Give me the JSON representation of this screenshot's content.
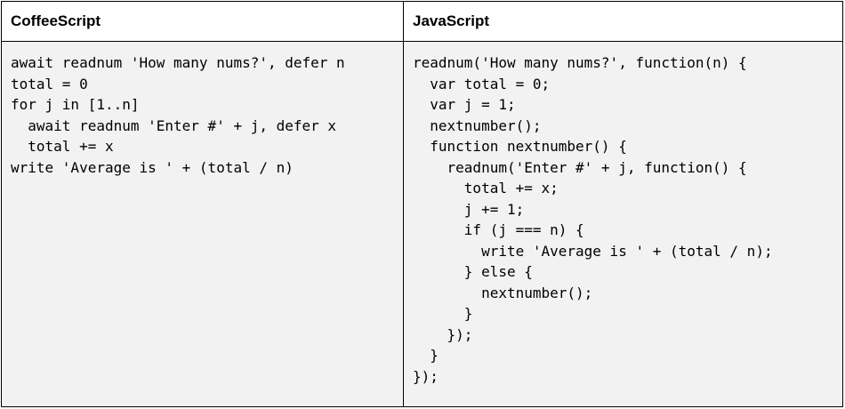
{
  "columns": [
    {
      "heading": "CoffeeScript",
      "code": "await readnum 'How many nums?', defer n\ntotal = 0\nfor j in [1..n]\n  await readnum 'Enter #' + j, defer x\n  total += x\nwrite 'Average is ' + (total / n)"
    },
    {
      "heading": "JavaScript",
      "code": "readnum('How many nums?', function(n) {\n  var total = 0;\n  var j = 1;\n  nextnumber();\n  function nextnumber() {\n    readnum('Enter #' + j, function() {\n      total += x;\n      j += 1;\n      if (j === n) {\n        write 'Average is ' + (total / n);\n      } else {\n        nextnumber();\n      }\n    });\n  }\n});"
    }
  ],
  "colors": {
    "code_background": "#f2f2f2",
    "header_background": "#ffffff",
    "border": "#000000",
    "text": "#000000"
  }
}
